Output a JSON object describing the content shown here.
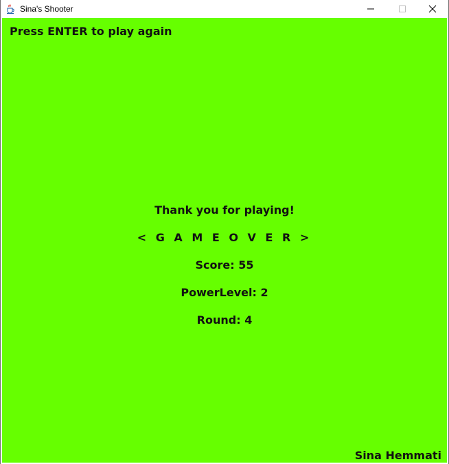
{
  "window": {
    "title": "Sina's Shooter",
    "icons": {
      "app": "java-cup-icon",
      "minimize": "minimize-icon",
      "maximize": "maximize-icon",
      "close": "close-icon"
    }
  },
  "game": {
    "background_color": "#66ff00",
    "restart_hint": "Press ENTER to play again",
    "thanks": "Thank you for playing!",
    "game_over": "< G A M E  O V E R >",
    "score_text": "Score: 55",
    "power_text": "PowerLevel: 2",
    "round_text": "Round: 4",
    "author": "Sina Hemmati"
  }
}
